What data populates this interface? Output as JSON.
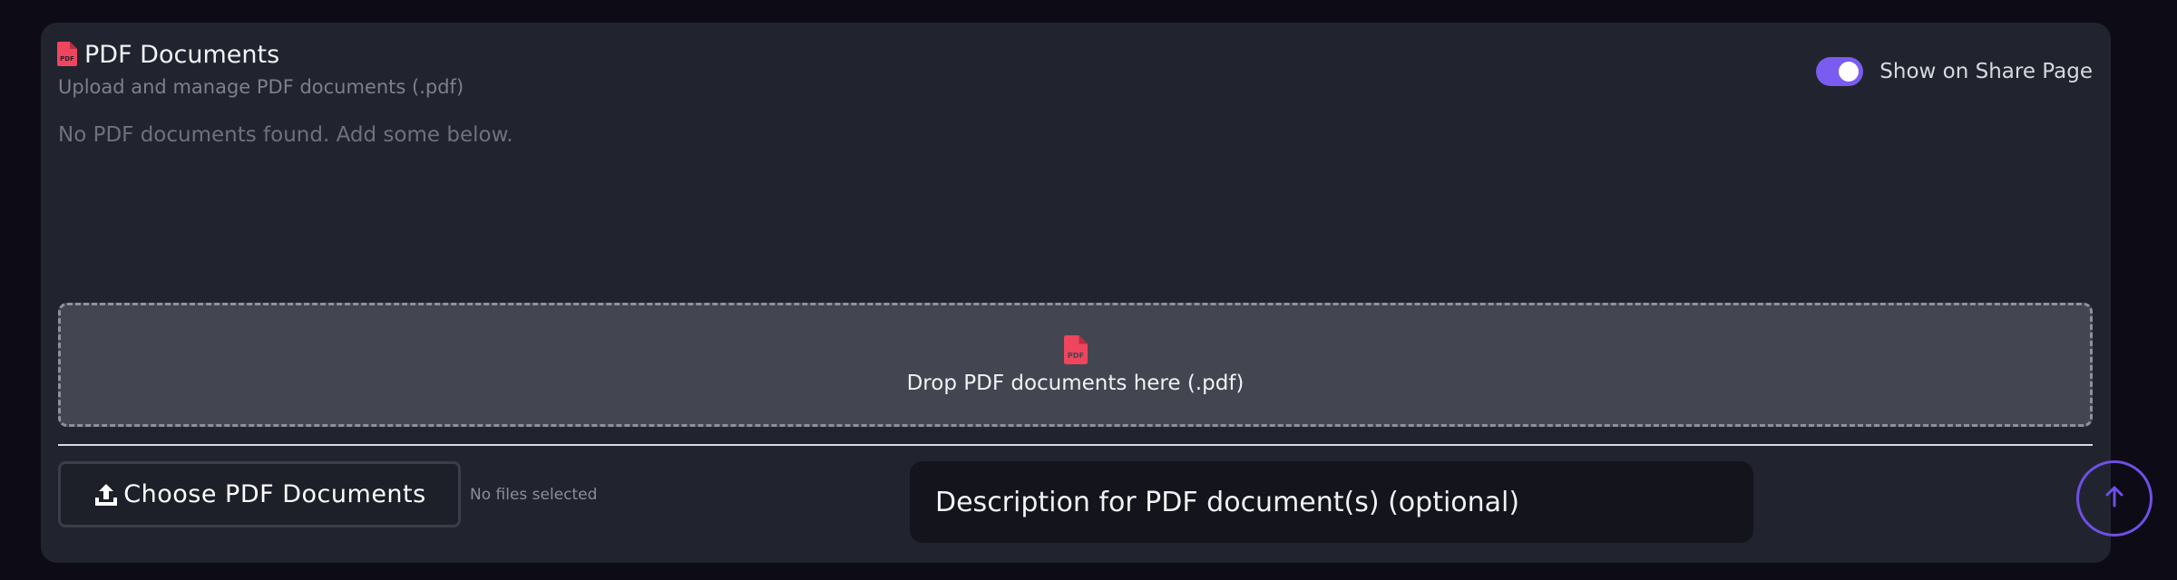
{
  "section": {
    "title": "PDF Documents",
    "subtitle": "Upload and manage PDF documents (.pdf)",
    "empty_message": "No PDF documents found. Add some below.",
    "icon": "pdf-file-icon",
    "icon_color": "#f0455f"
  },
  "share_toggle": {
    "label": "Show on Share Page",
    "enabled": true,
    "color": "#7b5cf0"
  },
  "dropzone": {
    "text": "Drop PDF documents here (.pdf)",
    "icon": "pdf-file-icon"
  },
  "upload": {
    "button_label": "Choose PDF Documents",
    "button_icon": "upload-icon",
    "status": "No files selected"
  },
  "description": {
    "placeholder": "Description for PDF document(s) (optional)"
  },
  "scroll_top": {
    "icon": "arrow-up-icon",
    "color": "#6f4fe6"
  }
}
